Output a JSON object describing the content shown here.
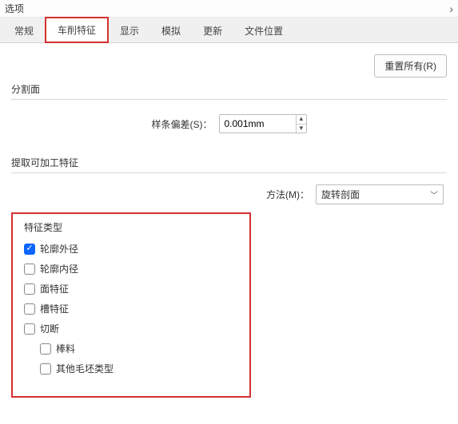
{
  "window": {
    "title": "选项"
  },
  "tabs": {
    "items": [
      {
        "label": "常规"
      },
      {
        "label": "车削特征"
      },
      {
        "label": "显示"
      },
      {
        "label": "模拟"
      },
      {
        "label": "更新"
      },
      {
        "label": "文件位置"
      }
    ],
    "active_index": 1
  },
  "reset_button": "重置所有(R)",
  "section_split": {
    "title": "分割面",
    "spline_label": "样条偏差(S)：",
    "spline_value": "0.001mm"
  },
  "section_extract": {
    "title": "提取可加工特征",
    "method_label": "方法(M)：",
    "method_value": "旋转剖面"
  },
  "feature_group": {
    "title": "特征类型",
    "items": [
      {
        "label": "轮廓外径",
        "checked": true,
        "indent": false
      },
      {
        "label": "轮廓内径",
        "checked": false,
        "indent": false
      },
      {
        "label": "面特征",
        "checked": false,
        "indent": false
      },
      {
        "label": "槽特征",
        "checked": false,
        "indent": false
      },
      {
        "label": "切断",
        "checked": false,
        "indent": false
      },
      {
        "label": "棒料",
        "checked": false,
        "indent": true
      },
      {
        "label": "其他毛坯类型",
        "checked": false,
        "indent": true
      }
    ]
  }
}
